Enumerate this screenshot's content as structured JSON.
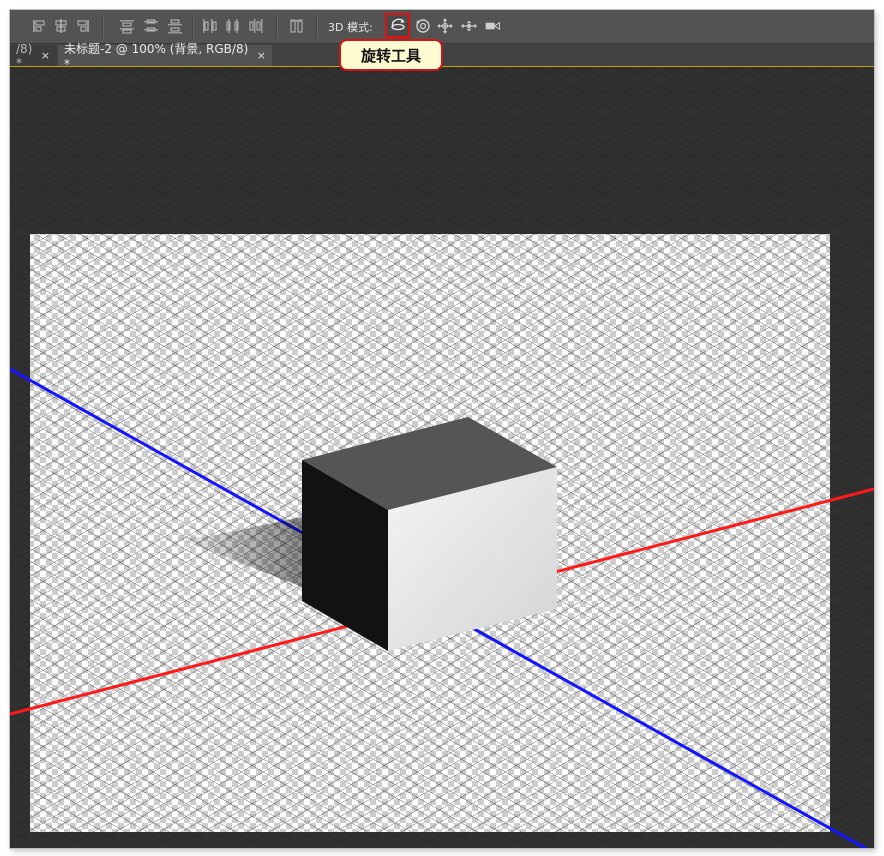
{
  "toolbar": {
    "align_icons": [
      "align-top-edges-icon",
      "align-vertical-centers-icon",
      "align-bottom-edges-icon",
      "distribute-top-icon",
      "distribute-vertical-centers-icon",
      "distribute-bottom-icon",
      "distribute-left-icon",
      "distribute-horizontal-centers-icon",
      "distribute-right-icon",
      "auto-align-layers-icon"
    ],
    "mode_label": "3D 模式:",
    "mode_tools": [
      "rotate-3d-icon",
      "roll-3d-icon",
      "drag-3d-icon",
      "slide-3d-icon",
      "scale-3d-camera-icon"
    ]
  },
  "tabs": [
    {
      "label": "/8) *",
      "close": "×"
    },
    {
      "label": "未标题-2 @ 100% (背景, RGB/8) *",
      "close": "×"
    }
  ],
  "callout": {
    "text": "旋转工具"
  },
  "colors": {
    "x_axis": "#ff1a1a",
    "z_axis": "#1414ff",
    "highlight": "#e01010",
    "callout_bg": "#fffbd0"
  }
}
